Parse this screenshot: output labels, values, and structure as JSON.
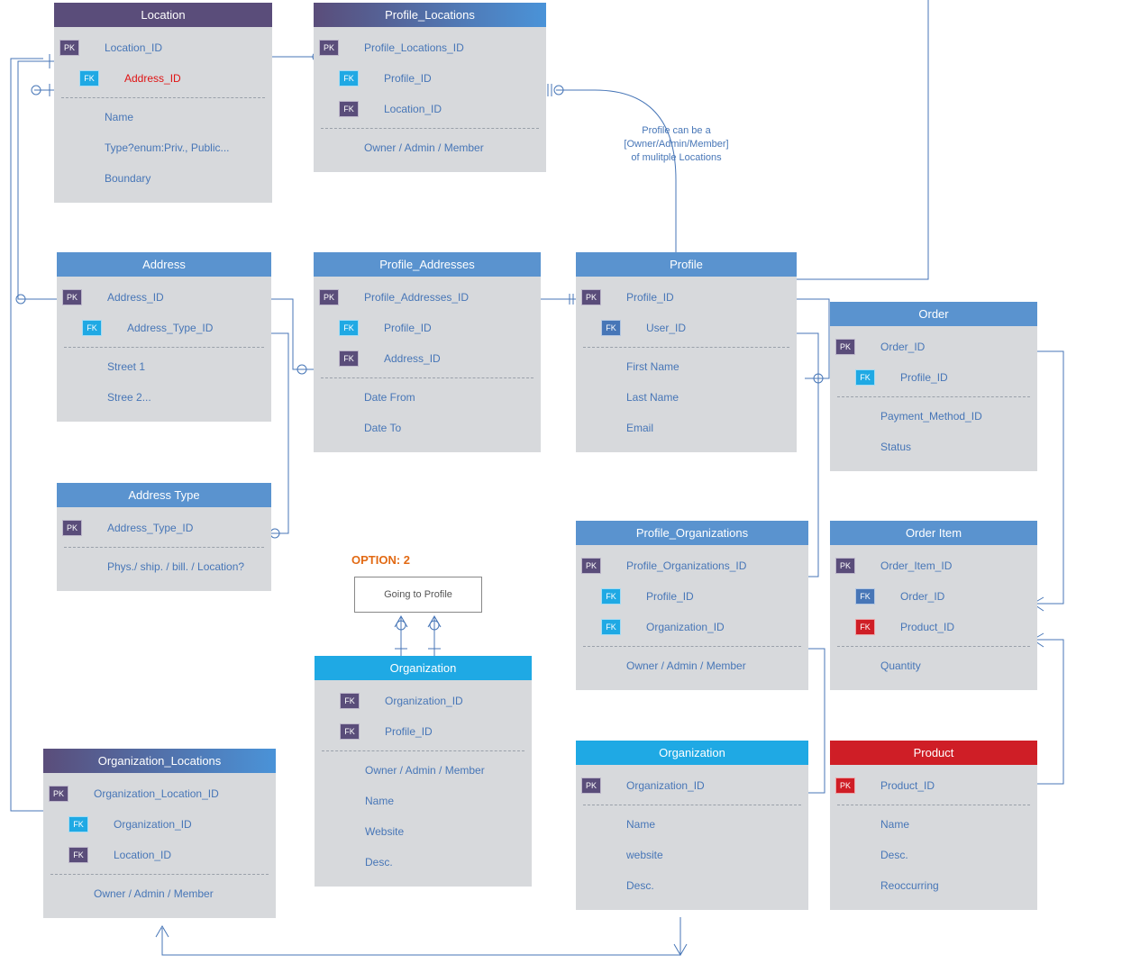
{
  "annotations": {
    "option2_label": "OPTION: 2",
    "going_to_profile": "Going to Profile",
    "profile_note": "Profile can be a\n[Owner/Admin/Member]\nof mulitple Locations"
  },
  "entities": {
    "location": {
      "title": "Location",
      "rows": [
        {
          "key": "PK",
          "kb": "purple",
          "label": "Location_ID"
        },
        {
          "key": "FK",
          "kb": "cyan",
          "label": "Address_ID",
          "color": "red"
        },
        {
          "type": "div"
        },
        {
          "label": "Name"
        },
        {
          "label": "Type?enum:Priv., Public..."
        },
        {
          "label": "Boundary"
        }
      ]
    },
    "profile_locations": {
      "title": "Profile_Locations",
      "rows": [
        {
          "key": "PK",
          "kb": "purple",
          "label": "Profile_Locations_ID"
        },
        {
          "key": "FK",
          "kb": "cyan",
          "label": "Profile_ID"
        },
        {
          "key": "FK",
          "kb": "purple",
          "label": "Location_ID"
        },
        {
          "type": "div"
        },
        {
          "label": "Owner / Admin / Member"
        }
      ]
    },
    "address": {
      "title": "Address",
      "rows": [
        {
          "key": "PK",
          "kb": "purple",
          "label": "Address_ID"
        },
        {
          "key": "FK",
          "kb": "cyan",
          "label": "Address_Type_ID"
        },
        {
          "type": "div"
        },
        {
          "label": "Street 1"
        },
        {
          "label": "Stree 2..."
        }
      ]
    },
    "profile_addresses": {
      "title": "Profile_Addresses",
      "rows": [
        {
          "key": "PK",
          "kb": "purple",
          "label": "Profile_Addresses_ID"
        },
        {
          "key": "FK",
          "kb": "cyan",
          "label": "Profile_ID"
        },
        {
          "key": "FK",
          "kb": "purple",
          "label": "Address_ID"
        },
        {
          "type": "div"
        },
        {
          "label": "Date From"
        },
        {
          "label": "Date To"
        }
      ]
    },
    "profile": {
      "title": "Profile",
      "rows": [
        {
          "key": "PK",
          "kb": "purple",
          "label": "Profile_ID"
        },
        {
          "key": "FK",
          "kb": "blue",
          "label": "User_ID"
        },
        {
          "type": "div"
        },
        {
          "label": "First Name"
        },
        {
          "label": "Last Name"
        },
        {
          "label": "Email"
        }
      ]
    },
    "order": {
      "title": "Order",
      "rows": [
        {
          "key": "PK",
          "kb": "purple",
          "label": "Order_ID"
        },
        {
          "key": "FK",
          "kb": "cyan",
          "label": "Profile_ID"
        },
        {
          "type": "div"
        },
        {
          "label": "Payment_Method_ID"
        },
        {
          "label": "Status"
        }
      ]
    },
    "address_type": {
      "title": "Address Type",
      "rows": [
        {
          "key": "PK",
          "kb": "purple",
          "label": "Address_Type_ID"
        },
        {
          "type": "div"
        },
        {
          "label": "Phys./ ship. / bill. / Location?"
        }
      ]
    },
    "profile_organizations": {
      "title": "Profile_Organizations",
      "rows": [
        {
          "key": "PK",
          "kb": "purple",
          "label": "Profile_Organizations_ID"
        },
        {
          "key": "FK",
          "kb": "cyan",
          "label": "Profile_ID"
        },
        {
          "key": "FK",
          "kb": "cyan",
          "label": "Organization_ID"
        },
        {
          "type": "div"
        },
        {
          "label": "Owner / Admin / Member"
        }
      ]
    },
    "order_item": {
      "title": "Order Item",
      "rows": [
        {
          "key": "PK",
          "kb": "purple",
          "label": "Order_Item_ID"
        },
        {
          "key": "FK",
          "kb": "blue",
          "label": "Order_ID"
        },
        {
          "key": "FK",
          "kb": "red",
          "label": "Product_ID"
        },
        {
          "type": "div"
        },
        {
          "label": "Quantity"
        }
      ]
    },
    "organization_opt2": {
      "title": "Organization",
      "rows": [
        {
          "key": "FK",
          "kb": "purple",
          "label": "Organization_ID"
        },
        {
          "key": "FK",
          "kb": "purple",
          "label": "Profile_ID"
        },
        {
          "type": "div"
        },
        {
          "label": "Owner / Admin / Member"
        },
        {
          "label": "Name"
        },
        {
          "label": "Website"
        },
        {
          "label": "Desc."
        }
      ]
    },
    "organization": {
      "title": "Organization",
      "rows": [
        {
          "key": "PK",
          "kb": "purple",
          "label": "Organization_ID"
        },
        {
          "type": "div"
        },
        {
          "label": "Name"
        },
        {
          "label": "website"
        },
        {
          "label": "Desc."
        }
      ]
    },
    "product": {
      "title": "Product",
      "rows": [
        {
          "key": "PK",
          "kb": "red",
          "label": "Product_ID"
        },
        {
          "type": "div"
        },
        {
          "label": "Name"
        },
        {
          "label": "Desc."
        },
        {
          "label": "Reoccurring"
        }
      ]
    },
    "organization_locations": {
      "title": "Organization_Locations",
      "rows": [
        {
          "key": "PK",
          "kb": "purple",
          "label": "Organization_Location_ID"
        },
        {
          "key": "FK",
          "kb": "cyan",
          "label": "Organization_ID"
        },
        {
          "key": "FK",
          "kb": "purple",
          "label": "Location_ID"
        },
        {
          "type": "div"
        },
        {
          "label": "Owner / Admin / Member"
        }
      ]
    }
  }
}
